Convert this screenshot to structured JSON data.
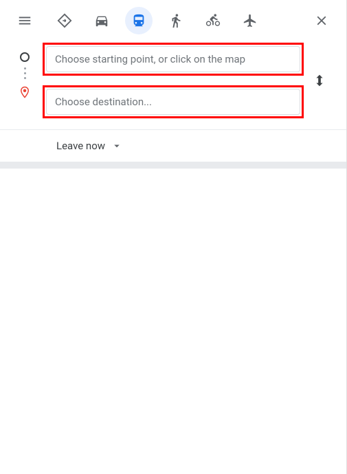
{
  "header": {
    "close_label": "Close directions"
  },
  "modes": {
    "best": "Best travel modes",
    "driving": "Driving",
    "transit": "Transit",
    "walking": "Walking",
    "cycling": "Cycling",
    "flights": "Flights",
    "active": "transit"
  },
  "inputs": {
    "origin_placeholder": "Choose starting point, or click on the map",
    "origin_value": "",
    "destination_placeholder": "Choose destination...",
    "destination_value": "",
    "swap_label": "Reverse starting point and destination"
  },
  "timing": {
    "label": "Leave now"
  }
}
